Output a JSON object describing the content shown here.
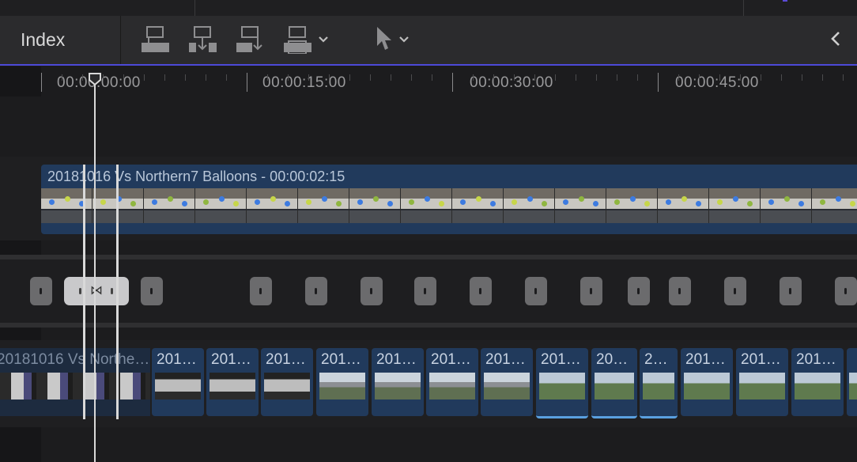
{
  "toolbar": {
    "index_label": "Index",
    "tools": [
      {
        "icon": "connect-clip-icon"
      },
      {
        "icon": "insert-clip-icon"
      },
      {
        "icon": "append-clip-icon"
      },
      {
        "icon": "overwrite-clip-icon"
      }
    ],
    "select_tool_icon": "arrow-pointer-icon",
    "back_icon": "chevron-left-icon"
  },
  "ruler": {
    "timecodes": [
      "00:00:00:00",
      "00:00:15:00",
      "00:00:30:00",
      "00:00:45:00"
    ]
  },
  "timeline": {
    "connected_clip_title": "20181016 Vs Northern7 Balloons - 00:00:02:15",
    "compound_clip_label": "20181016 Vs Northe…",
    "clip_labels": [
      "201…",
      "201…",
      "201…",
      "201…",
      "201…",
      "201…",
      "201…",
      "201…",
      "20…",
      "2…",
      "201…",
      "201…",
      "201…"
    ],
    "transition_symbol": "⋈"
  },
  "colors": {
    "accent": "#4d4ad8",
    "clip_blue": "#213a5c"
  }
}
